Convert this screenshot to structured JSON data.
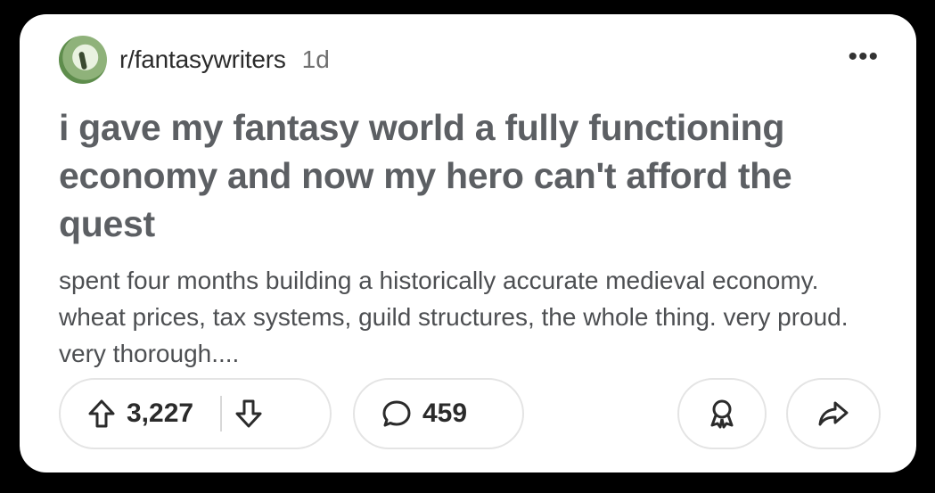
{
  "post": {
    "subreddit": "r/fantasywriters",
    "age": "1d",
    "more_label": "•••",
    "title": "i gave my fantasy world a fully functioning economy and now my hero can't afford the quest",
    "body": "spent four months building a historically accurate medieval economy. wheat prices, tax systems, guild structures, the whole thing. very proud. very thorough...."
  },
  "actions": {
    "upvotes": "3,227",
    "comments": "459"
  },
  "icons": {
    "upvote": "arrow-up-icon",
    "downvote": "arrow-down-icon",
    "comment": "speech-bubble-icon",
    "award": "award-icon",
    "share": "share-arrow-icon"
  },
  "colors": {
    "background": "#000000",
    "card": "#ffffff",
    "title_text": "#5c5f63",
    "pill_border": "#e4e4e4"
  }
}
